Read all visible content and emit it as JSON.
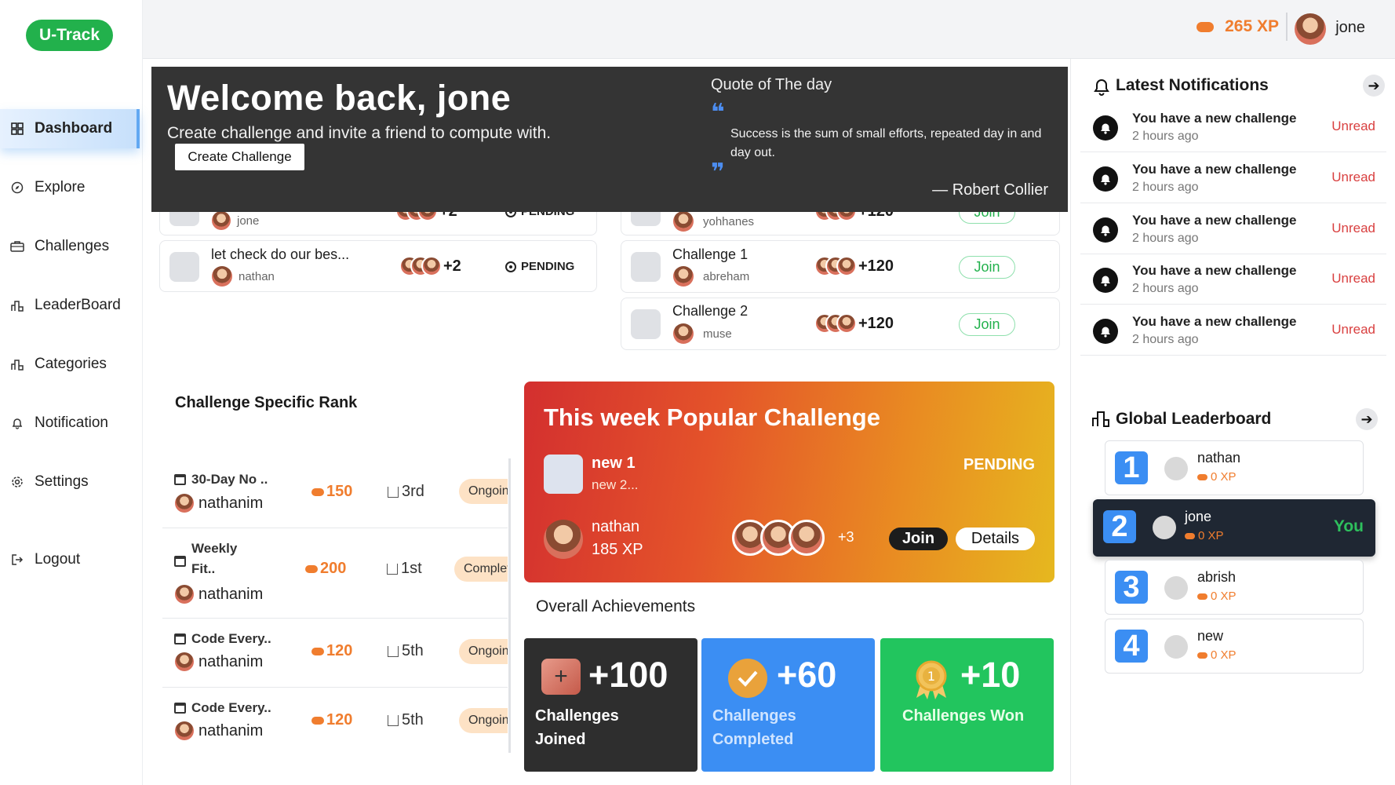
{
  "app": {
    "logo": "U-Track"
  },
  "sidebar": {
    "items": [
      {
        "label": "Dashboard",
        "icon": "grid-icon"
      },
      {
        "label": "Explore",
        "icon": "compass-icon"
      },
      {
        "label": "Challenges",
        "icon": "briefcase-icon"
      },
      {
        "label": "LeaderBoard",
        "icon": "bar-chart-icon"
      },
      {
        "label": "Categories",
        "icon": "bar-chart-icon"
      },
      {
        "label": "Notification",
        "icon": "bell-icon"
      },
      {
        "label": "Settings",
        "icon": "gear-icon"
      },
      {
        "label": "Logout",
        "icon": "logout-icon"
      }
    ]
  },
  "topbar": {
    "xp": "265 XP",
    "username": "jone"
  },
  "hero": {
    "title": "Welcome back, jone",
    "subtitle": "Create challenge and invite a friend to compute with.",
    "button": "Create Challenge",
    "quote_heading": "Quote of The day",
    "quote_open": "❝",
    "quote_close": "❞",
    "quote": "Success is the sum of small efforts, repeated day in and day out.",
    "author": "— Robert Collier"
  },
  "my_challenges": [
    {
      "title": "",
      "user": "jone",
      "extra": "+2",
      "status": "PENDING"
    },
    {
      "title": "let check do our bes...",
      "user": "nathan",
      "extra": "+2",
      "status": "PENDING"
    }
  ],
  "other_challenges": [
    {
      "title": "",
      "user": "yohhanes",
      "extra": "+120",
      "action": "Join"
    },
    {
      "title": "Challenge 1",
      "user": "abreham",
      "extra": "+120",
      "action": "Join"
    },
    {
      "title": "Challenge 2",
      "user": "muse",
      "extra": "+120",
      "action": "Join"
    }
  ],
  "rank": {
    "title": "Challenge Specific Rank",
    "rows": [
      {
        "name": "30-Day No ..",
        "user": "nathanim",
        "xp": "150",
        "rank": "3rd",
        "status": "Ongoing"
      },
      {
        "name": "Weekly Fit..",
        "user": "nathanim",
        "xp": "200",
        "rank": "1st",
        "status": "Completed"
      },
      {
        "name": "Code Every..",
        "user": "nathanim",
        "xp": "120",
        "rank": "5th",
        "status": "Ongoing"
      },
      {
        "name": "Code Every..",
        "user": "nathanim",
        "xp": "120",
        "rank": "5th",
        "status": "Ongoing"
      }
    ]
  },
  "popular": {
    "title": "This week Popular Challenge",
    "name": "new 1",
    "desc": "new 2...",
    "status": "PENDING",
    "user": "nathan",
    "xp": "185 XP",
    "more": "+3",
    "join": "Join",
    "details": "Details"
  },
  "achievements": {
    "title": "Overall Achievements",
    "items": [
      {
        "value": "+100",
        "label": "Challenges Joined",
        "color": "#2e2e2e"
      },
      {
        "value": "+60",
        "label": "Challenges Completed",
        "color": "#3b8ef3"
      },
      {
        "value": "+10",
        "label": "Challenges Won",
        "color": "#22c55e"
      }
    ]
  },
  "notifications": {
    "title": "Latest Notifications",
    "items": [
      {
        "text": "You have a new challenge",
        "time": "2 hours ago",
        "status": "Unread"
      },
      {
        "text": "You have a new challenge",
        "time": "2 hours ago",
        "status": "Unread"
      },
      {
        "text": "You have a new challenge",
        "time": "2 hours ago",
        "status": "Unread"
      },
      {
        "text": "You have a new challenge",
        "time": "2 hours ago",
        "status": "Unread"
      },
      {
        "text": "You have a new challenge",
        "time": "2 hours ago",
        "status": "Unread"
      }
    ]
  },
  "leaderboard": {
    "title": "Global Leaderboard",
    "you_label": "You",
    "entries": [
      {
        "rank": "1",
        "name": "nathan",
        "xp": "0 XP"
      },
      {
        "rank": "2",
        "name": "jone",
        "xp": "0 XP"
      },
      {
        "rank": "3",
        "name": "abrish",
        "xp": "0 XP"
      },
      {
        "rank": "4",
        "name": "new",
        "xp": "0 XP"
      }
    ]
  },
  "colors": {
    "brand": "#22b14c",
    "accent": "#3b8ef3",
    "xp": "#f07d2e",
    "unread": "#d94040"
  }
}
